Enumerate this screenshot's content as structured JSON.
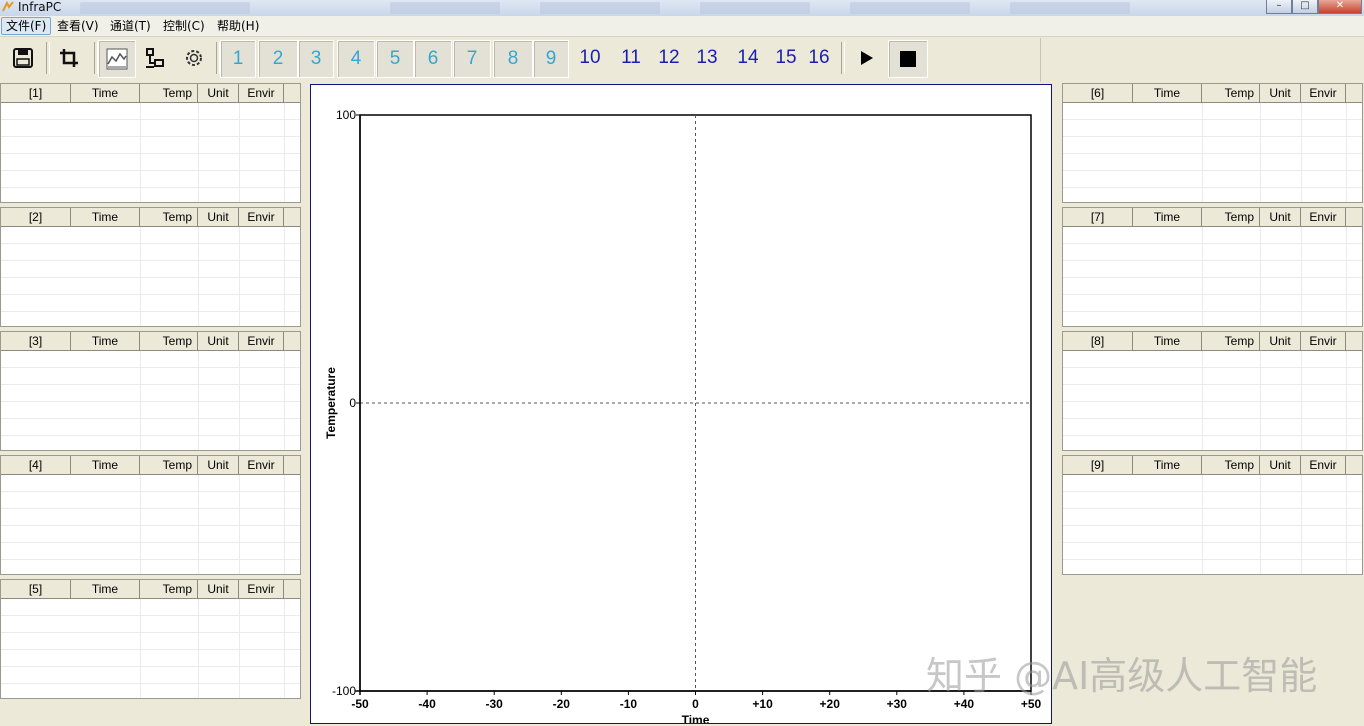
{
  "window": {
    "title": "InfraPC"
  },
  "menu": [
    "文件(F)",
    "查看(V)",
    "通道(T)",
    "控制(C)",
    "帮助(H)"
  ],
  "toolbar": {
    "channels": [
      "1",
      "2",
      "3",
      "4",
      "5",
      "6",
      "7",
      "8",
      "9",
      "10",
      "11",
      "12",
      "13",
      "14",
      "15",
      "16"
    ],
    "light_channel_color": "#35a7cf",
    "dark_channel_color": "#1a1fb4",
    "icons": [
      "save-icon",
      "crop-icon",
      "chart-icon",
      "network-icon",
      "gear-icon",
      "play-icon",
      "stop-icon"
    ]
  },
  "panels": [
    {
      "label": "[1]",
      "columns": [
        "Time",
        "Temp",
        "Unit",
        "Envir"
      ]
    },
    {
      "label": "[2]",
      "columns": [
        "Time",
        "Temp",
        "Unit",
        "Envir"
      ]
    },
    {
      "label": "[3]",
      "columns": [
        "Time",
        "Temp",
        "Unit",
        "Envir"
      ]
    },
    {
      "label": "[4]",
      "columns": [
        "Time",
        "Temp",
        "Unit",
        "Envir"
      ]
    },
    {
      "label": "[5]",
      "columns": [
        "Time",
        "Temp",
        "Unit",
        "Envir"
      ]
    },
    {
      "label": "[6]",
      "columns": [
        "Time",
        "Temp",
        "Unit",
        "Envir"
      ]
    },
    {
      "label": "[7]",
      "columns": [
        "Time",
        "Temp",
        "Unit",
        "Envir"
      ]
    },
    {
      "label": "[8]",
      "columns": [
        "Time",
        "Temp",
        "Unit",
        "Envir"
      ]
    },
    {
      "label": "[9]",
      "columns": [
        "Time",
        "Temp",
        "Unit",
        "Envir"
      ]
    }
  ],
  "chart_data": {
    "type": "line",
    "series": [],
    "xlabel": "Time",
    "ylabel": "Temperature",
    "xlim": [
      -50,
      50
    ],
    "ylim": [
      -100,
      100
    ],
    "x_ticks": [
      "-50",
      "-40",
      "-30",
      "-20",
      "-10",
      "0",
      "+10",
      "+20",
      "+30",
      "+40",
      "+50"
    ],
    "y_ticks": [
      "100",
      "0",
      "-100"
    ],
    "grid": "dashed zero lines"
  },
  "watermark": "知乎 @AI高级人工智能"
}
